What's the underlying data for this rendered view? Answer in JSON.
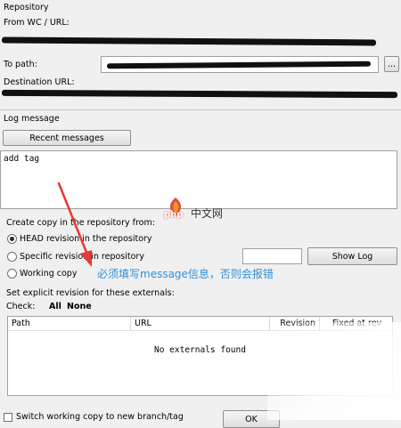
{
  "repository": {
    "section_label": "Repository",
    "from_label": "From WC / URL:",
    "to_path_label": "To path:",
    "browse_label": "...",
    "destination_label": "Destination URL:"
  },
  "log": {
    "section_label": "Log message",
    "recent_button": "Recent messages",
    "message": "add tag"
  },
  "copy": {
    "section_label": "Create copy in the repository from:",
    "options": [
      {
        "label": "HEAD revision in the repository",
        "selected": true
      },
      {
        "label": "Specific revision in repository",
        "selected": false
      },
      {
        "label": "Working copy",
        "selected": false
      }
    ],
    "show_log_button": "Show Log"
  },
  "annotation": {
    "text": "必须填写message信息，否则会报错",
    "color": "#2f8fd8"
  },
  "externals": {
    "section_label": "Set explicit revision for these externals:",
    "check_label": "Check:",
    "all_link": "All",
    "none_link": "None",
    "columns": [
      "Path",
      "URL",
      "Revision",
      "Fixed at rev"
    ],
    "empty_text": "No externals found"
  },
  "footer": {
    "switch_label": "Switch working copy to new branch/tag",
    "ok_button": "OK"
  },
  "logo": {
    "php": "php",
    "cn": "中文网"
  }
}
